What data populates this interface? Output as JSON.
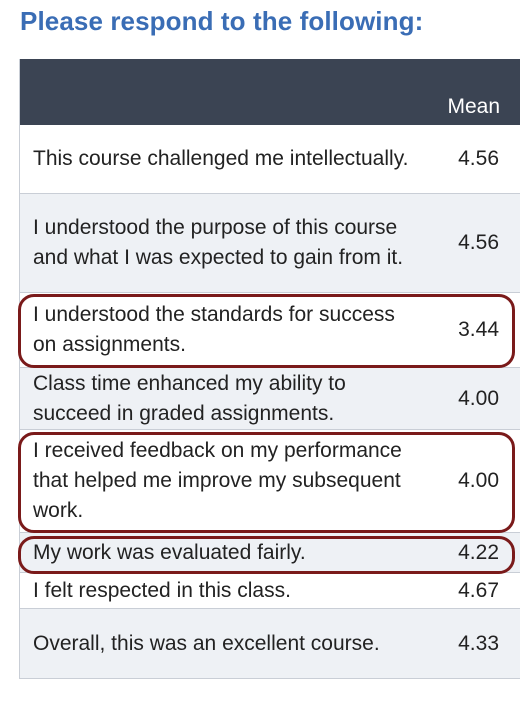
{
  "heading": "Please respond to the following:",
  "table": {
    "column_header": "Mean",
    "rows": [
      {
        "question": "This course challenged me intellectually.",
        "mean": "4.56",
        "highlighted": false
      },
      {
        "question": "I understood the purpose of this course and what I was expected to gain from it.",
        "mean": "4.56",
        "highlighted": false
      },
      {
        "question": "I understood the standards for success on assignments.",
        "mean": "3.44",
        "highlighted": true
      },
      {
        "question": "Class time enhanced my ability to succeed in graded assignments.",
        "mean": "4.00",
        "highlighted": false
      },
      {
        "question": "I received feedback on my performance that helped me improve my subsequent work.",
        "mean": "4.00",
        "highlighted": true
      },
      {
        "question": "My work was evaluated fairly.",
        "mean": "4.22",
        "highlighted": true
      },
      {
        "question": "I felt respected in this class.",
        "mean": "4.67",
        "highlighted": false
      },
      {
        "question": "Overall, this was an excellent course.",
        "mean": "4.33",
        "highlighted": false
      }
    ]
  },
  "colors": {
    "heading": "#3a6db5",
    "header_bg": "#3b4453",
    "highlight_border": "#7a1a1a",
    "alt_row_bg": "#eef1f5"
  }
}
